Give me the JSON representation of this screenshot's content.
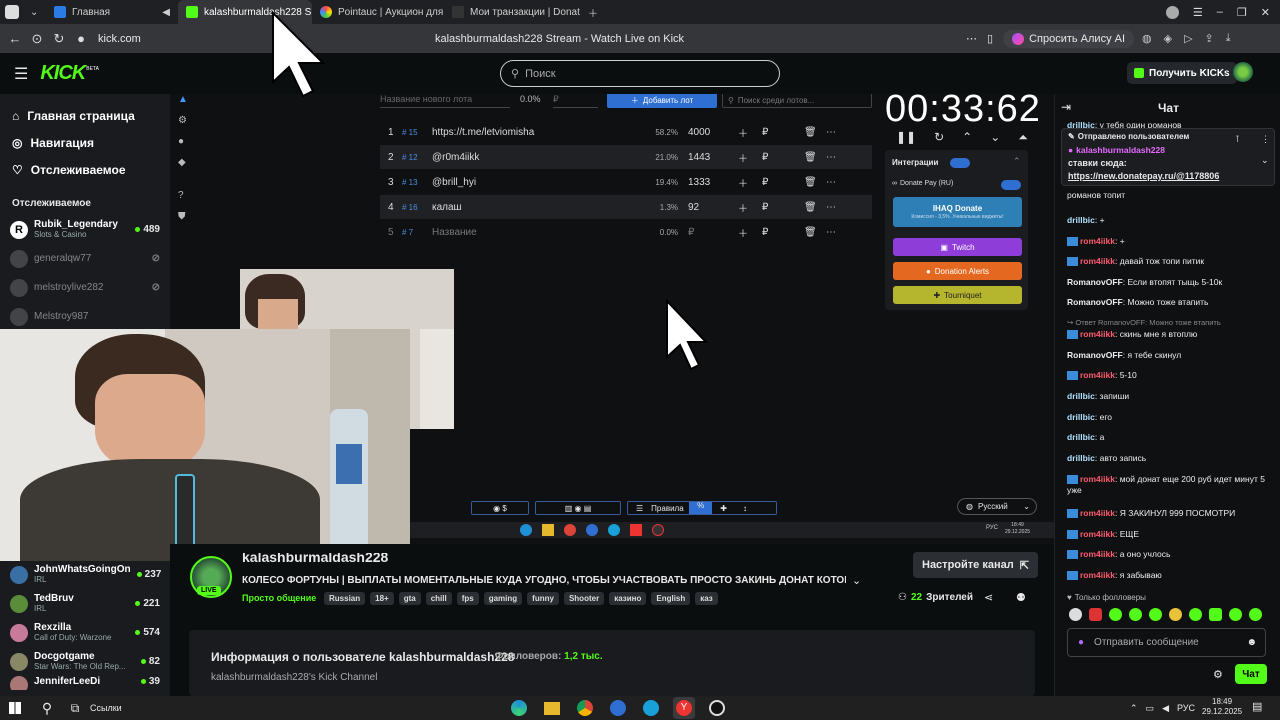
{
  "browser": {
    "tabs": [
      {
        "label": "Главная",
        "active": false
      },
      {
        "label": "kalashburmaldash228 S",
        "active": true
      },
      {
        "label": "Pointauc | Аукцион для ст",
        "active": false
      },
      {
        "label": "Мои транзакции | Donate",
        "active": false
      }
    ],
    "url": "kick.com",
    "page_title": "kalashburmaldash228 Stream - Watch Live on Kick",
    "alisa_label": "Спросить Алису AI"
  },
  "kick": {
    "logo": "KICK",
    "logo_beta": "BETA",
    "search_placeholder": "Поиск",
    "get_kicks": "Получить KICKs"
  },
  "sidebar": {
    "nav": [
      {
        "label": "Главная страница",
        "icon": "home-icon"
      },
      {
        "label": "Навигация",
        "icon": "compass-icon"
      },
      {
        "label": "Отслеживаемое",
        "icon": "heart-icon"
      }
    ],
    "section_title": "Отслеживаемое",
    "followed": [
      {
        "name": "Rubik_Legendary",
        "sub": "Slots & Casino",
        "viewers": "489",
        "live": true
      },
      {
        "name": "generalqw77",
        "sub": "",
        "viewers": "",
        "live": false
      },
      {
        "name": "melstroylive282",
        "sub": "",
        "viewers": "",
        "live": false
      },
      {
        "name": "Melstroy987",
        "sub": "",
        "viewers": "",
        "live": false
      }
    ],
    "recommended": [
      {
        "name": "JohnWhatsGoingOn",
        "sub": "IRL",
        "viewers": "237"
      },
      {
        "name": "TedBruv",
        "sub": "IRL",
        "viewers": "221"
      },
      {
        "name": "Rexzilla",
        "sub": "Call of Duty: Warzone",
        "viewers": "574"
      },
      {
        "name": "Docgotgame",
        "sub": "Star Wars: The Old Rep...",
        "viewers": "82"
      },
      {
        "name": "JenniferLeeDi",
        "sub": "",
        "viewers": "39"
      }
    ]
  },
  "auction": {
    "new_lot_placeholder": "Название нового лота",
    "new_lot_pct": "0.0%",
    "new_lot_currency": "₽",
    "add_lot": "Добавить лот",
    "search_lots": "Поиск среди лотов...",
    "lots": [
      {
        "n": "1",
        "id": "# 15",
        "name": "https://t.me/letviomisha",
        "pct": "58.2%",
        "amount": "4000"
      },
      {
        "n": "2",
        "id": "# 12",
        "name": "@r0m4iikk",
        "pct": "21.0%",
        "amount": "1443"
      },
      {
        "n": "3",
        "id": "# 13",
        "name": "@brill_hyi",
        "pct": "19.4%",
        "amount": "1333"
      },
      {
        "n": "4",
        "id": "# 16",
        "name": "калаш",
        "pct": "1.3%",
        "amount": "92"
      },
      {
        "n": "5",
        "id": "# 7",
        "name": "Название",
        "pct": "0.0%",
        "amount": "₽"
      }
    ],
    "timer": "00:33:62",
    "integrations_title": "Интеграции",
    "donatepay": "Donate Pay (RU)",
    "ihaq": "IHAQ Donate",
    "ihaq_sub": "Комиссия - 3,5%. Уникальные виджеты!",
    "twitch": "Twitch",
    "donation_alerts": "Donation Alerts",
    "tourniquet": "Tourniquet",
    "language": "Русский",
    "toolbar": [
      "Правила"
    ]
  },
  "stream": {
    "streamer": "kalashburmaldash228",
    "title": "КОЛЕСО ФОРТУНЫ | ВЫПЛАТЫ МОМЕНТАЛЬНЫЕ КУДА УГОДНО, ЧТОБЫ УЧАСТВОВАТЬ ПРОСТО ЗАКИНЬ ДОНАТ КОТОРЫЙ С...",
    "category": "Просто общение",
    "live_badge": "LIVE",
    "tags": [
      "Russian",
      "18+",
      "gta",
      "chill",
      "fps",
      "gaming",
      "funny",
      "Shooter",
      "казино",
      "English",
      "каз"
    ],
    "setup_channel": "Настройте канал",
    "viewers": "22",
    "viewers_label": "Зрителей",
    "about_title": "Информация о пользователе kalashburmaldash228",
    "followers_label": "Фолловеров:",
    "followers": "1,2 тыс.",
    "about_desc": "kalashburmaldash228's Kick Channel"
  },
  "chat": {
    "title": "Чат",
    "pinned_label": "Отправлено пользователем",
    "pinned_user": "kalashburmaldash228",
    "pinned_text": "ставки сюда:",
    "pinned_link": "https://new.donatepay.ru/@1178806",
    "messages": [
      {
        "user": "drillbic",
        "text": "у тебя один романов",
        "type": "drill"
      },
      {
        "user": "",
        "text": "романов топит",
        "type": "none"
      },
      {
        "user": "drillbic",
        "text": "+",
        "type": "drill"
      },
      {
        "user": "rom4iikk",
        "text": "+",
        "type": "rom"
      },
      {
        "user": "rom4iikk",
        "text": "давай тож топи питик",
        "type": "rom"
      },
      {
        "user": "RomanovOFF",
        "text": "Если втопят тыщь 5-10к",
        "type": "roff"
      },
      {
        "user": "RomanovOFF",
        "text": "Можно тоже втапить",
        "type": "roff"
      },
      {
        "user": "",
        "text": "Ответ RomanovOFF: Можно тоже втапить",
        "type": "reply"
      },
      {
        "user": "rom4iikk",
        "text": "скинь мне я втоплю",
        "type": "rom"
      },
      {
        "user": "RomanovOFF",
        "text": "я тебе скинул",
        "type": "roff"
      },
      {
        "user": "rom4iikk",
        "text": "5-10",
        "type": "rom"
      },
      {
        "user": "drillbic",
        "text": "запиши",
        "type": "drill"
      },
      {
        "user": "drillbic",
        "text": "его",
        "type": "drill"
      },
      {
        "user": "drillbic",
        "text": "а",
        "type": "drill"
      },
      {
        "user": "drillbic",
        "text": "авто запись",
        "type": "drill"
      },
      {
        "user": "rom4iikk",
        "text": "мой донат еще 200 руб идет минут 5 уже",
        "type": "rom"
      },
      {
        "user": "rom4iikk",
        "text": "Я ЗАКИНУЛ 999 ПОСМОТРИ",
        "type": "rom"
      },
      {
        "user": "rom4iikk",
        "text": "ЕЩЕ",
        "type": "rom"
      },
      {
        "user": "rom4iikk",
        "text": "а оно учлось",
        "type": "rom"
      },
      {
        "user": "rom4iikk",
        "text": "я забываю",
        "type": "rom"
      }
    ],
    "followers_only": "Только фолловеры",
    "send_placeholder": "Отправить сообщение",
    "chat_button": "Чат"
  },
  "taskbar": {
    "search_label": "Ссылки",
    "lang": "РУС",
    "time": "18:49",
    "date": "29.12.2025"
  },
  "video_taskbar": {
    "lang": "РУС",
    "time": "18:49",
    "date": "29.12.2025"
  }
}
